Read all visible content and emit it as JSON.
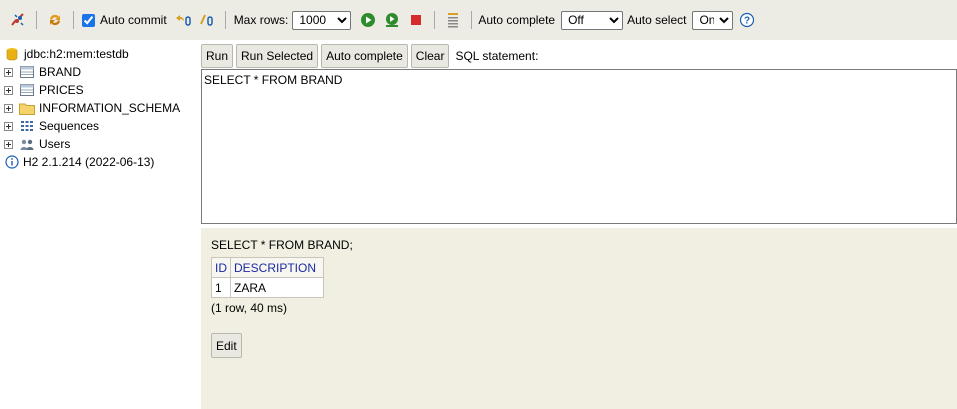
{
  "toolbar": {
    "auto_commit_label": "Auto commit",
    "auto_commit_checked": true,
    "max_rows_label": "Max rows:",
    "max_rows_value": "1000",
    "auto_complete_label": "Auto complete",
    "auto_complete_value": "Off",
    "auto_select_label": "Auto select",
    "auto_select_value": "On",
    "help_glyph": "?",
    "icons": [
      "disconnect-icon",
      "refresh-icon",
      "rollback-icon",
      "commit-icon",
      "run-icon",
      "run-selected-icon",
      "stop-icon",
      "history-icon",
      "help-icon"
    ]
  },
  "tree": {
    "connection": "jdbc:h2:mem:testdb",
    "items": [
      {
        "label": "BRAND",
        "icon": "table-icon"
      },
      {
        "label": "PRICES",
        "icon": "table-icon"
      },
      {
        "label": "INFORMATION_SCHEMA",
        "icon": "folder-icon"
      },
      {
        "label": "Sequences",
        "icon": "sequences-icon"
      },
      {
        "label": "Users",
        "icon": "users-icon"
      }
    ],
    "version": "H2 2.1.214 (2022-06-13)"
  },
  "query": {
    "run_label": "Run",
    "run_selected_label": "Run Selected",
    "auto_complete_label": "Auto complete",
    "clear_label": "Clear",
    "sql_statement_label": "SQL statement:",
    "sql_text": "SELECT * FROM BRAND"
  },
  "result": {
    "sql": "SELECT * FROM BRAND;",
    "columns": [
      "ID",
      "DESCRIPTION"
    ],
    "rows": [
      [
        "1",
        "ZARA"
      ]
    ],
    "info": "(1 row, 40 ms)",
    "edit_label": "Edit"
  },
  "colors": {
    "toolbar_bg": "#ecebe4",
    "result_bg": "#f1efe2",
    "column_header": "#1a2aa0",
    "run_green": "#2e8b2e",
    "stop_red": "#d62b2b",
    "help_blue": "#1a5fb4"
  }
}
